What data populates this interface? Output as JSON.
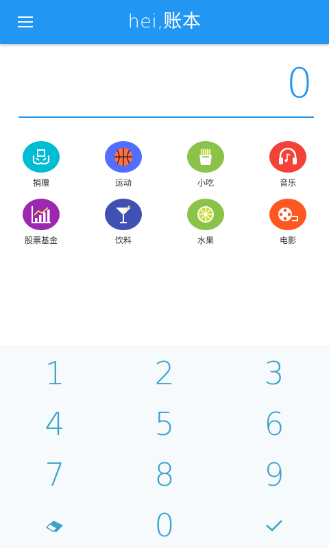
{
  "header": {
    "title_latin": "hei,",
    "title_cjk": "账本",
    "menu_icon": "menu-icon",
    "color": "#2196f3"
  },
  "amount": {
    "value": "0"
  },
  "categories": [
    {
      "label": "捐赠",
      "icon": "donation-icon",
      "color": "#00bcd4"
    },
    {
      "label": "运动",
      "icon": "basketball-icon",
      "color": "#536dfe"
    },
    {
      "label": "小吃",
      "icon": "fries-icon",
      "color": "#8bc34a"
    },
    {
      "label": "音乐",
      "icon": "headphones-icon",
      "color": "#f44336"
    },
    {
      "label": "股票基金",
      "icon": "stock-chart-icon",
      "color": "#9c27b0"
    },
    {
      "label": "饮料",
      "icon": "cocktail-icon",
      "color": "#3f51b5"
    },
    {
      "label": "水果",
      "icon": "lime-icon",
      "color": "#8bc34a"
    },
    {
      "label": "电影",
      "icon": "film-reel-icon",
      "color": "#ff5722"
    }
  ],
  "keypad": {
    "keys": [
      "1",
      "2",
      "3",
      "4",
      "5",
      "6",
      "7",
      "8",
      "9",
      "0"
    ],
    "clear_icon": "eraser-icon",
    "confirm_icon": "check-icon"
  }
}
